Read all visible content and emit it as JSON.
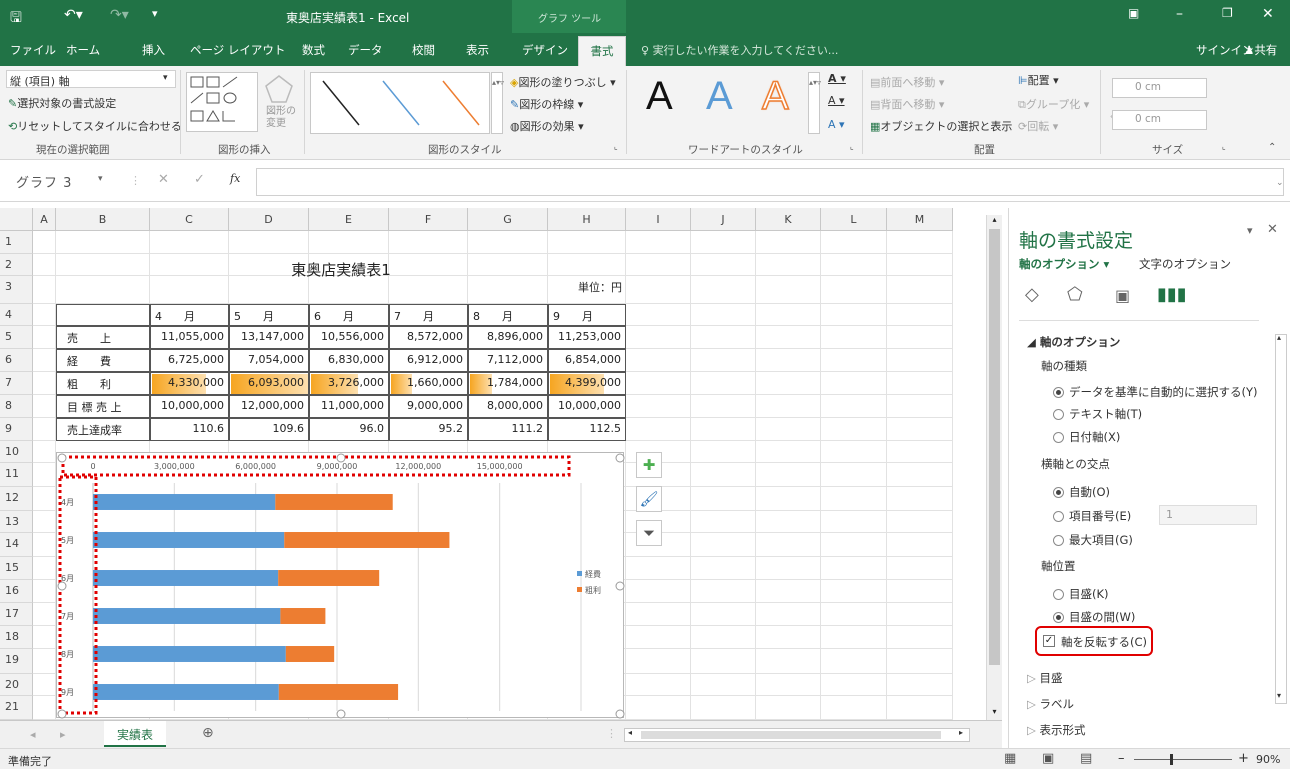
{
  "window": {
    "title": "東奥店実績表1 - Excel",
    "tool_tab": "グラフ ツール",
    "icons": [
      "save-icon",
      "undo-icon",
      "redo-icon",
      "ribbon-display-icon",
      "minimize-icon",
      "restore-icon",
      "close-icon"
    ]
  },
  "tabs": [
    "ファイル",
    "ホーム",
    "挿入",
    "ページ レイアウト",
    "数式",
    "データ",
    "校閲",
    "表示",
    "デザイン",
    "書式"
  ],
  "active_tab": "書式",
  "tell_me": "実行したい作業を入力してください...",
  "signin": "サインイン",
  "share": "共有",
  "ribbon": {
    "selection": {
      "value": "縦 (項目) 軸",
      "format": "選択対象の書式設定",
      "reset": "リセットしてスタイルに合わせる",
      "group": "現在の選択範囲"
    },
    "insert_shapes": {
      "change": "図形の変更",
      "group": "図形の挿入"
    },
    "shape_styles": {
      "fill": "図形の塗りつぶし",
      "outline": "図形の枠線",
      "effects": "図形の効果",
      "group": "図形のスタイル"
    },
    "wordart": {
      "letter": "A",
      "group": "ワードアートのスタイル"
    },
    "arrange": {
      "forward": "前面へ移動",
      "backward": "背面へ移動",
      "selection_pane": "オブジェクトの選択と表示",
      "align": "配置",
      "group_btn": "グループ化",
      "rotate": "回転",
      "group": "配置"
    },
    "size": {
      "height": "0 cm",
      "width": "0 cm",
      "group": "サイズ"
    }
  },
  "formula": {
    "name_box": "グラフ 3",
    "fx": "fx",
    "value": ""
  },
  "columns": [
    "A",
    "B",
    "C",
    "D",
    "E",
    "F",
    "G",
    "H",
    "I",
    "J",
    "K",
    "L",
    "M"
  ],
  "rows": [
    "1",
    "2",
    "3",
    "4",
    "5",
    "6",
    "7",
    "8",
    "9",
    "10",
    "11",
    "12",
    "13",
    "14",
    "15",
    "16",
    "17",
    "18",
    "19",
    "20",
    "21"
  ],
  "table": {
    "title": "東奥店実績表1",
    "unit": "単位：円",
    "months": [
      "4　　月",
      "5　　月",
      "6　　月",
      "7　　月",
      "8　　月",
      "9　　月"
    ],
    "rows": [
      {
        "label": "売　　上",
        "values": [
          "11,055,000",
          "13,147,000",
          "10,556,000",
          "8,572,000",
          "8,896,000",
          "11,253,000"
        ]
      },
      {
        "label": "経　　費",
        "values": [
          "6,725,000",
          "7,054,000",
          "6,830,000",
          "6,912,000",
          "7,112,000",
          "6,854,000"
        ]
      },
      {
        "label": "粗　　利",
        "values": [
          "4,330,000",
          "6,093,000",
          "3,726,000",
          "1,660,000",
          "1,784,000",
          "4,399,000"
        ],
        "databar": [
          0.71,
          1.0,
          0.61,
          0.27,
          0.29,
          0.72
        ]
      },
      {
        "label": "目 標 売 上",
        "values": [
          "10,000,000",
          "12,000,000",
          "11,000,000",
          "9,000,000",
          "8,000,000",
          "10,000,000"
        ]
      },
      {
        "label": "売上達成率",
        "values": [
          "110.6",
          "109.6",
          "96.0",
          "95.2",
          "111.2",
          "112.5"
        ]
      }
    ]
  },
  "chart_data": {
    "type": "bar",
    "orientation": "horizontal",
    "stacked": true,
    "categories": [
      "4月",
      "5月",
      "6月",
      "7月",
      "8月",
      "9月"
    ],
    "series": [
      {
        "name": "経費",
        "values": [
          6725000,
          7054000,
          6830000,
          6912000,
          7112000,
          6854000
        ],
        "color": "#5b9bd5"
      },
      {
        "name": "粗利",
        "values": [
          4330000,
          6093000,
          3726000,
          1660000,
          1784000,
          4399000
        ],
        "color": "#ed7d31"
      }
    ],
    "xticks": [
      "0",
      "3,000,000",
      "6,000,000",
      "9,000,000",
      "12,000,000",
      "15,000,000"
    ],
    "xlim": [
      0,
      18000000
    ],
    "y_axis_reversed": true,
    "x_axis_position": "top",
    "legend": "right",
    "grid": true
  },
  "sheet_tab": "実績表",
  "status": {
    "ready": "準備完了",
    "zoom": "90%"
  },
  "pane": {
    "title": "軸の書式設定",
    "tab_axis": "軸のオプション",
    "tab_text": "文字のオプション",
    "section": "軸のオプション",
    "axis_type": "軸の種類",
    "opt_auto": "データを基準に自動的に選択する(Y)",
    "opt_text": "テキスト軸(T)",
    "opt_date": "日付軸(X)",
    "cross": "横軸との交点",
    "cross_auto": "自動(O)",
    "cross_item": "項目番号(E)",
    "cross_item_value": "1",
    "cross_max": "最大項目(G)",
    "pos": "軸位置",
    "pos_on": "目盛(K)",
    "pos_between": "目盛の間(W)",
    "reverse": "軸を反転する(C)",
    "ticks": "目盛",
    "labels": "ラベル",
    "number": "表示形式"
  }
}
